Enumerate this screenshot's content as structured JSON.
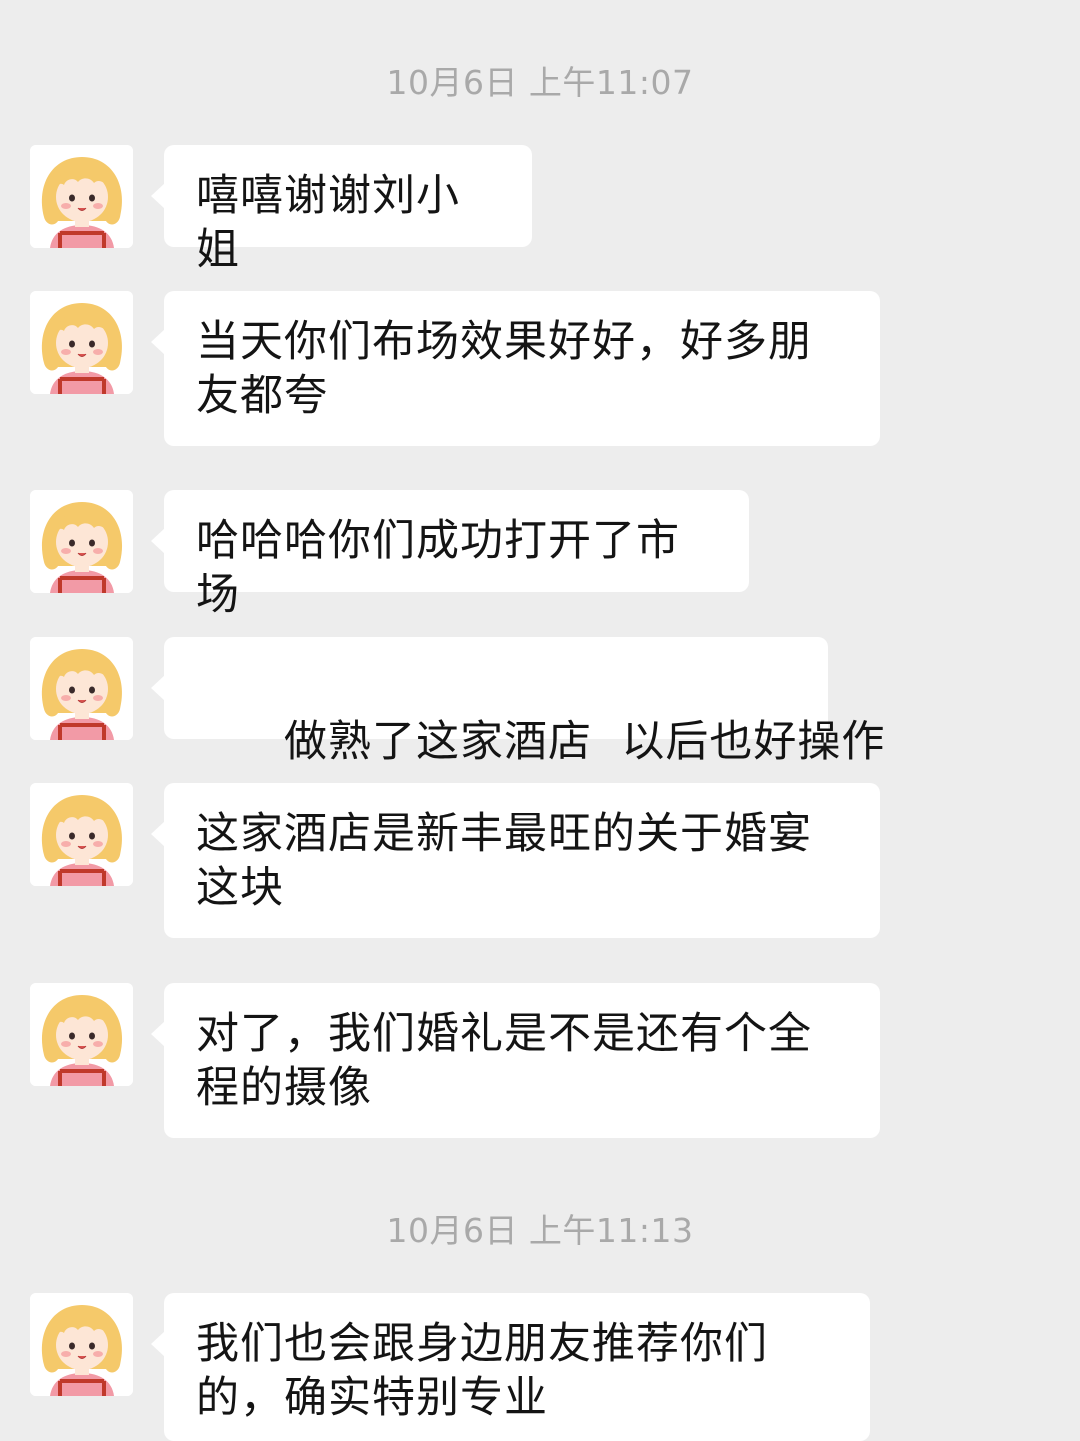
{
  "timestamps": [
    "10月6日 上午11:07",
    "10月6日 上午11:13"
  ],
  "messages": [
    {
      "text": "嘻嘻谢谢刘小姐"
    },
    {
      "text": "当天你们布场效果好好，好多朋友都夸"
    },
    {
      "text": "哈哈哈你们成功打开了市场"
    },
    {
      "text": "做熟了这家酒店  以后也好操作"
    },
    {
      "text": "这家酒店是新丰最旺的关于婚宴这块"
    },
    {
      "text": "对了，我们婚礼是不是还有个全程的摄像"
    },
    {
      "text": "我们也会跟身边朋友推荐你们的，确实特别专业"
    }
  ],
  "avatar": {
    "icon": "girl-avatar-icon"
  },
  "colors": {
    "background": "#ededed",
    "bubble": "#ffffff",
    "text": "#141414",
    "timestamp": "#a9a9a9",
    "hair": "#f5c96a",
    "dress": "#f29aa6"
  }
}
